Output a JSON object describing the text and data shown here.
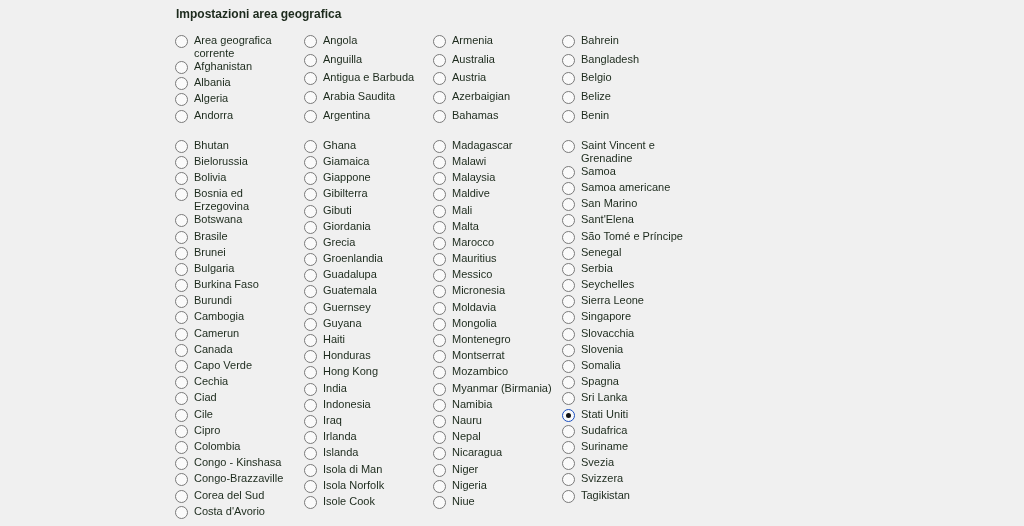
{
  "title": "Impostazioni area geografica",
  "groups": [
    {
      "columns": [
        {
          "items": [
            {
              "label": "Area geografica corrente",
              "selected": false
            },
            {
              "label": "Afghanistan",
              "selected": false
            },
            {
              "label": "Albania",
              "selected": false
            },
            {
              "label": "Algeria",
              "selected": false
            },
            {
              "label": "Andorra",
              "selected": false
            }
          ]
        },
        {
          "items": [
            {
              "label": "Angola",
              "selected": false
            },
            {
              "label": "Anguilla",
              "selected": false
            },
            {
              "label": "Antigua e Barbuda",
              "selected": false
            },
            {
              "label": "Arabia Saudita",
              "selected": false
            },
            {
              "label": "Argentina",
              "selected": false
            }
          ]
        },
        {
          "items": [
            {
              "label": "Armenia",
              "selected": false
            },
            {
              "label": "Australia",
              "selected": false
            },
            {
              "label": "Austria",
              "selected": false
            },
            {
              "label": "Azerbaigian",
              "selected": false
            },
            {
              "label": "Bahamas",
              "selected": false
            }
          ]
        },
        {
          "items": [
            {
              "label": "Bahrein",
              "selected": false
            },
            {
              "label": "Bangladesh",
              "selected": false
            },
            {
              "label": "Belgio",
              "selected": false
            },
            {
              "label": "Belize",
              "selected": false
            },
            {
              "label": "Benin",
              "selected": false
            }
          ]
        }
      ]
    },
    {
      "columns": [
        {
          "items": [
            {
              "label": "Bhutan",
              "selected": false
            },
            {
              "label": "Bielorussia",
              "selected": false
            },
            {
              "label": "Bolivia",
              "selected": false
            },
            {
              "label": "Bosnia ed Erzegovina",
              "selected": false
            },
            {
              "label": "Botswana",
              "selected": false
            },
            {
              "label": "Brasile",
              "selected": false
            },
            {
              "label": "Brunei",
              "selected": false
            },
            {
              "label": "Bulgaria",
              "selected": false
            },
            {
              "label": "Burkina Faso",
              "selected": false
            },
            {
              "label": "Burundi",
              "selected": false
            },
            {
              "label": "Cambogia",
              "selected": false
            },
            {
              "label": "Camerun",
              "selected": false
            },
            {
              "label": "Canada",
              "selected": false
            },
            {
              "label": "Capo Verde",
              "selected": false
            },
            {
              "label": "Cechia",
              "selected": false
            },
            {
              "label": "Ciad",
              "selected": false
            },
            {
              "label": "Cile",
              "selected": false
            },
            {
              "label": "Cipro",
              "selected": false
            },
            {
              "label": "Colombia",
              "selected": false
            },
            {
              "label": "Congo - Kinshasa",
              "selected": false
            },
            {
              "label": "Congo-Brazzaville",
              "selected": false
            },
            {
              "label": "Corea del Sud",
              "selected": false
            },
            {
              "label": "Costa d'Avorio",
              "selected": false
            }
          ]
        },
        {
          "items": [
            {
              "label": "Ghana",
              "selected": false
            },
            {
              "label": "Giamaica",
              "selected": false
            },
            {
              "label": "Giappone",
              "selected": false
            },
            {
              "label": "Gibilterra",
              "selected": false
            },
            {
              "label": "Gibuti",
              "selected": false
            },
            {
              "label": "Giordania",
              "selected": false
            },
            {
              "label": "Grecia",
              "selected": false
            },
            {
              "label": "Groenlandia",
              "selected": false
            },
            {
              "label": "Guadalupa",
              "selected": false
            },
            {
              "label": "Guatemala",
              "selected": false
            },
            {
              "label": "Guernsey",
              "selected": false
            },
            {
              "label": "Guyana",
              "selected": false
            },
            {
              "label": "Haiti",
              "selected": false
            },
            {
              "label": "Honduras",
              "selected": false
            },
            {
              "label": "Hong Kong",
              "selected": false
            },
            {
              "label": "India",
              "selected": false
            },
            {
              "label": "Indonesia",
              "selected": false
            },
            {
              "label": "Iraq",
              "selected": false
            },
            {
              "label": "Irlanda",
              "selected": false
            },
            {
              "label": "Islanda",
              "selected": false
            },
            {
              "label": "Isola di Man",
              "selected": false
            },
            {
              "label": "Isola Norfolk",
              "selected": false
            },
            {
              "label": "Isole Cook",
              "selected": false
            }
          ]
        },
        {
          "items": [
            {
              "label": "Madagascar",
              "selected": false
            },
            {
              "label": "Malawi",
              "selected": false
            },
            {
              "label": "Malaysia",
              "selected": false
            },
            {
              "label": "Maldive",
              "selected": false
            },
            {
              "label": "Mali",
              "selected": false
            },
            {
              "label": "Malta",
              "selected": false
            },
            {
              "label": "Marocco",
              "selected": false
            },
            {
              "label": "Mauritius",
              "selected": false
            },
            {
              "label": "Messico",
              "selected": false
            },
            {
              "label": "Micronesia",
              "selected": false
            },
            {
              "label": "Moldavia",
              "selected": false
            },
            {
              "label": "Mongolia",
              "selected": false
            },
            {
              "label": "Montenegro",
              "selected": false
            },
            {
              "label": "Montserrat",
              "selected": false
            },
            {
              "label": "Mozambico",
              "selected": false
            },
            {
              "label": "Myanmar (Birmania)",
              "selected": false
            },
            {
              "label": "Namibia",
              "selected": false
            },
            {
              "label": "Nauru",
              "selected": false
            },
            {
              "label": "Nepal",
              "selected": false
            },
            {
              "label": "Nicaragua",
              "selected": false
            },
            {
              "label": "Niger",
              "selected": false
            },
            {
              "label": "Nigeria",
              "selected": false
            },
            {
              "label": "Niue",
              "selected": false
            }
          ]
        },
        {
          "items": [
            {
              "label": "Saint Vincent e Grenadine",
              "selected": false
            },
            {
              "label": "Samoa",
              "selected": false
            },
            {
              "label": "Samoa americane",
              "selected": false
            },
            {
              "label": "San Marino",
              "selected": false
            },
            {
              "label": "Sant'Elena",
              "selected": false
            },
            {
              "label": "São Tomé e Príncipe",
              "selected": false
            },
            {
              "label": "Senegal",
              "selected": false
            },
            {
              "label": "Serbia",
              "selected": false
            },
            {
              "label": "Seychelles",
              "selected": false
            },
            {
              "label": "Sierra Leone",
              "selected": false
            },
            {
              "label": "Singapore",
              "selected": false
            },
            {
              "label": "Slovacchia",
              "selected": false
            },
            {
              "label": "Slovenia",
              "selected": false
            },
            {
              "label": "Somalia",
              "selected": false
            },
            {
              "label": "Spagna",
              "selected": false
            },
            {
              "label": "Sri Lanka",
              "selected": false
            },
            {
              "label": "Stati Uniti",
              "selected": true
            },
            {
              "label": "Sudafrica",
              "selected": false
            },
            {
              "label": "Suriname",
              "selected": false
            },
            {
              "label": "Svezia",
              "selected": false
            },
            {
              "label": "Svizzera",
              "selected": false
            },
            {
              "label": "Tagikistan",
              "selected": false
            }
          ]
        }
      ]
    }
  ]
}
